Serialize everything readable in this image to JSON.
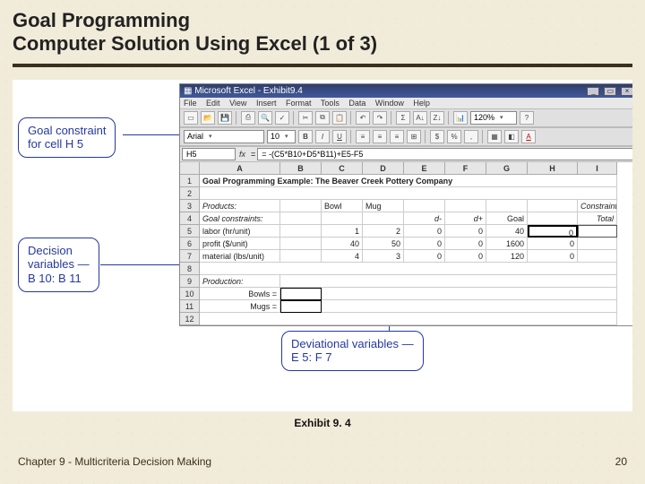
{
  "slide": {
    "title_line1": "Goal Programming",
    "title_line2": "Computer Solution Using Excel (1 of 3)",
    "exhibit_label": "Exhibit 9. 4",
    "chapter_footer": "Chapter 9 - Multicriteria Decision Making",
    "page_number": "20"
  },
  "callouts": {
    "c1": {
      "line1": "Goal constraint",
      "line2": "for cell H 5"
    },
    "c2": {
      "line1": "Decision",
      "line2": "variables —",
      "line3": "B 10: B 11"
    },
    "c3": {
      "line1": "Deviational variables —",
      "line2": "E 5: F 7"
    }
  },
  "excel": {
    "title": "Microsoft Excel - Exhibit9.4",
    "menu": [
      "File",
      "Edit",
      "View",
      "Insert",
      "Format",
      "Tools",
      "Data",
      "Window",
      "Help"
    ],
    "font_name": "Arial",
    "font_size": "10",
    "zoom": "120%",
    "namebox": "H5",
    "formula": "= -(C5*B10+D5*B11)+E5-F5",
    "col_headers": [
      "A",
      "B",
      "C",
      "D",
      "E",
      "F",
      "G",
      "H",
      "I"
    ],
    "rows_idx": [
      "1",
      "2",
      "3",
      "4",
      "5",
      "6",
      "7",
      "8",
      "9",
      "10",
      "11",
      "12"
    ],
    "r1A": "Goal Programming Example: The Beaver Creek Pottery Company",
    "r3A": "Products:",
    "r3C": "Bowl",
    "r3D": "Mug",
    "r3I": "Constraint",
    "r4A": "Goal constraints:",
    "r4E": "d-",
    "r4F": "d+",
    "r4G": "Goal",
    "r4I": "Total",
    "r5A": "labor (hr/unit)",
    "r5C": "1",
    "r5D": "2",
    "r5E": "0",
    "r5F": "0",
    "r5G": "40",
    "r5H": "0",
    "r6A": "profit ($/unit)",
    "r6C": "40",
    "r6D": "50",
    "r6E": "0",
    "r6F": "0",
    "r6G": "1600",
    "r6H": "0",
    "r7A": "material (lbs/unit)",
    "r7C": "4",
    "r7D": "3",
    "r7E": "0",
    "r7F": "0",
    "r7G": "120",
    "r7H": "0",
    "r9A": "Production:",
    "r10A": "Bowls =",
    "r11A": "Mugs ="
  }
}
